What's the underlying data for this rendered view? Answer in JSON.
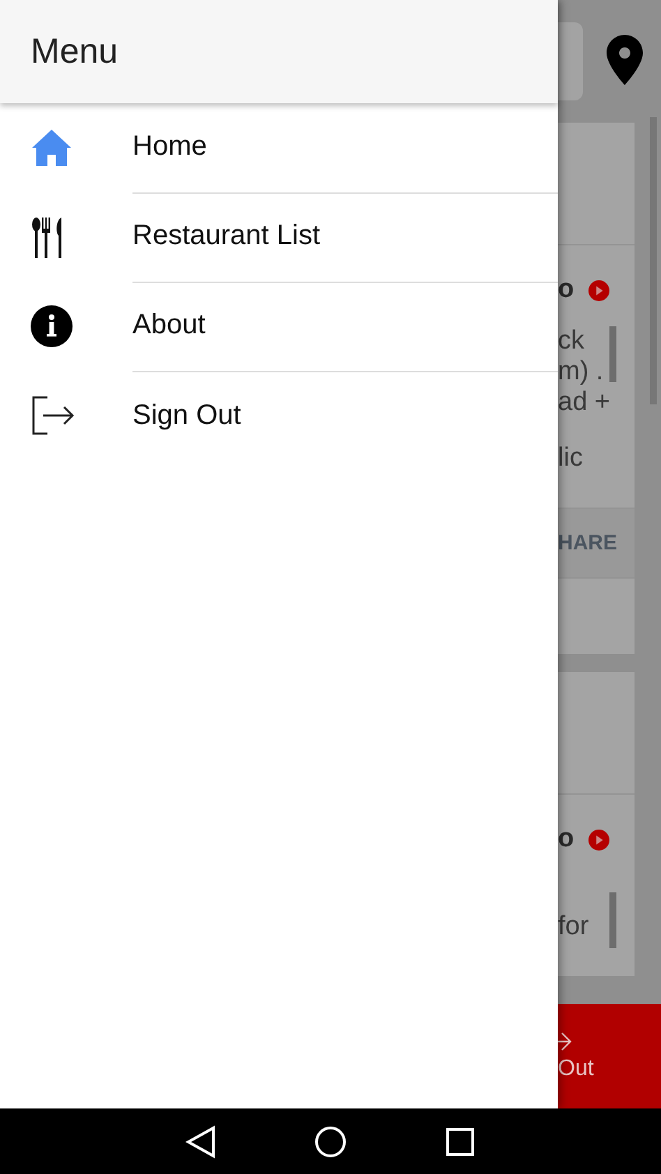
{
  "drawer": {
    "title": "Menu",
    "items": [
      {
        "label": "Home"
      },
      {
        "label": "Restaurant List"
      },
      {
        "label": "About"
      },
      {
        "label": "Sign Out"
      }
    ]
  },
  "background": {
    "cards": [
      {
        "heading": "o",
        "lines": [
          "ck",
          "m) .",
          "ad +",
          "lic"
        ],
        "action": "HARE"
      },
      {
        "heading": "o",
        "lines": [
          "for"
        ]
      }
    ],
    "bottom_button": "Out"
  }
}
